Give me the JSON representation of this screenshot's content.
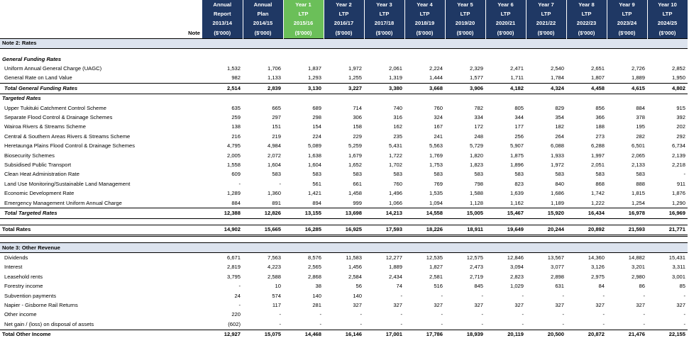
{
  "header": {
    "note": "Note",
    "columns": [
      {
        "l1": "Annual",
        "l2": "Report",
        "l3": "2013/14",
        "l4": "($'000)",
        "hl": false
      },
      {
        "l1": "Annual",
        "l2": "Plan",
        "l3": "2014/15",
        "l4": "($'000)",
        "hl": false
      },
      {
        "l1": "Year 1",
        "l2": "LTP",
        "l3": "2015/16",
        "l4": "($'000)",
        "hl": true
      },
      {
        "l1": "Year 2",
        "l2": "LTP",
        "l3": "2016/17",
        "l4": "($'000)",
        "hl": false
      },
      {
        "l1": "Year 3",
        "l2": "LTP",
        "l3": "2017/18",
        "l4": "($'000)",
        "hl": false
      },
      {
        "l1": "Year 4",
        "l2": "LTP",
        "l3": "2018/19",
        "l4": "($'000)",
        "hl": false
      },
      {
        "l1": "Year 5",
        "l2": "LTP",
        "l3": "2019/20",
        "l4": "($'000)",
        "hl": false
      },
      {
        "l1": "Year 6",
        "l2": "LTP",
        "l3": "2020/21",
        "l4": "($'000)",
        "hl": false
      },
      {
        "l1": "Year 7",
        "l2": "LTP",
        "l3": "2021/22",
        "l4": "($'000)",
        "hl": false
      },
      {
        "l1": "Year 8",
        "l2": "LTP",
        "l3": "2022/23",
        "l4": "($'000)",
        "hl": false
      },
      {
        "l1": "Year 9",
        "l2": "LTP",
        "l3": "2023/24",
        "l4": "($'000)",
        "hl": false
      },
      {
        "l1": "Year 10",
        "l2": "LTP",
        "l3": "2024/25",
        "l4": "($'000)",
        "hl": false
      }
    ]
  },
  "rows": [
    {
      "type": "section",
      "label": "Note 2: Rates"
    },
    {
      "type": "spacer"
    },
    {
      "type": "subhead",
      "label": "General Funding Rates"
    },
    {
      "type": "item",
      "label": "Uniform Annual General Charge (UAGC)",
      "values": [
        "1,532",
        "1,706",
        "1,837",
        "1,972",
        "2,061",
        "2,224",
        "2,329",
        "2,471",
        "2,540",
        "2,651",
        "2,726",
        "2,852"
      ]
    },
    {
      "type": "item",
      "label": "General Rate on Land Value",
      "values": [
        "982",
        "1,133",
        "1,293",
        "1,255",
        "1,319",
        "1,444",
        "1,577",
        "1,711",
        "1,784",
        "1,807",
        "1,889",
        "1,950"
      ]
    },
    {
      "type": "total",
      "label": "Total General Funding Rates",
      "values": [
        "2,514",
        "2,839",
        "3,130",
        "3,227",
        "3,380",
        "3,668",
        "3,906",
        "4,182",
        "4,324",
        "4,458",
        "4,615",
        "4,802"
      ]
    },
    {
      "type": "subhead",
      "label": "Targeted Rates"
    },
    {
      "type": "item",
      "label": "Upper Tukituki Catchment Control Scheme",
      "values": [
        "635",
        "665",
        "689",
        "714",
        "740",
        "760",
        "782",
        "805",
        "829",
        "856",
        "884",
        "915"
      ]
    },
    {
      "type": "item",
      "label": "Separate Flood Control & Drainage Schemes",
      "values": [
        "259",
        "297",
        "298",
        "306",
        "316",
        "324",
        "334",
        "344",
        "354",
        "366",
        "378",
        "392"
      ]
    },
    {
      "type": "item",
      "label": "Wairoa Rivers & Streams Scheme",
      "values": [
        "138",
        "151",
        "154",
        "158",
        "162",
        "167",
        "172",
        "177",
        "182",
        "188",
        "195",
        "202"
      ]
    },
    {
      "type": "item",
      "label": "Central & Southern Areas Rivers & Streams Scheme",
      "values": [
        "216",
        "219",
        "224",
        "229",
        "235",
        "241",
        "248",
        "256",
        "264",
        "273",
        "282",
        "292"
      ]
    },
    {
      "type": "item",
      "label": "Heretaunga Plains Flood Control & Drainage Schemes",
      "values": [
        "4,795",
        "4,984",
        "5,089",
        "5,259",
        "5,431",
        "5,563",
        "5,729",
        "5,907",
        "6,088",
        "6,288",
        "6,501",
        "6,734"
      ]
    },
    {
      "type": "item",
      "label": "Biosecurity Schemes",
      "values": [
        "2,005",
        "2,072",
        "1,638",
        "1,679",
        "1,722",
        "1,769",
        "1,820",
        "1,875",
        "1,933",
        "1,997",
        "2,065",
        "2,139"
      ]
    },
    {
      "type": "item",
      "label": "Subsidised Public Transport",
      "values": [
        "1,558",
        "1,604",
        "1,604",
        "1,652",
        "1,702",
        "1,753",
        "1,823",
        "1,896",
        "1,972",
        "2,051",
        "2,133",
        "2,218"
      ]
    },
    {
      "type": "item",
      "label": "Clean Heat Administration Rate",
      "values": [
        "609",
        "583",
        "583",
        "583",
        "583",
        "583",
        "583",
        "583",
        "583",
        "583",
        "583",
        "-"
      ]
    },
    {
      "type": "item",
      "label": "Land Use Monitoring/Sustainable Land Management",
      "values": [
        "-",
        "-",
        "561",
        "661",
        "760",
        "769",
        "798",
        "823",
        "840",
        "868",
        "888",
        "911"
      ]
    },
    {
      "type": "item",
      "label": "Economic Development Rate",
      "values": [
        "1,289",
        "1,360",
        "1,421",
        "1,458",
        "1,496",
        "1,535",
        "1,588",
        "1,639",
        "1,686",
        "1,742",
        "1,815",
        "1,876"
      ]
    },
    {
      "type": "item",
      "label": "Emergency Management Uniform Annual Charge",
      "values": [
        "884",
        "891",
        "894",
        "999",
        "1,066",
        "1,094",
        "1,128",
        "1,162",
        "1,189",
        "1,222",
        "1,254",
        "1,290"
      ]
    },
    {
      "type": "total",
      "label": "Total Targeted Rates",
      "values": [
        "12,388",
        "12,826",
        "13,155",
        "13,698",
        "14,213",
        "14,558",
        "15,005",
        "15,467",
        "15,920",
        "16,434",
        "16,978",
        "16,969"
      ]
    },
    {
      "type": "spacer"
    },
    {
      "type": "grand",
      "label": "Total Rates",
      "values": [
        "14,902",
        "15,665",
        "16,285",
        "16,925",
        "17,593",
        "18,226",
        "18,911",
        "19,649",
        "20,244",
        "20,892",
        "21,593",
        "21,771"
      ]
    },
    {
      "type": "spacer"
    },
    {
      "type": "section",
      "label": "Note 3: Other Revenue"
    },
    {
      "type": "item",
      "label": "Dividends",
      "values": [
        "6,671",
        "7,563",
        "8,576",
        "11,583",
        "12,277",
        "12,535",
        "12,575",
        "12,846",
        "13,567",
        "14,360",
        "14,882",
        "15,431"
      ]
    },
    {
      "type": "item",
      "label": "Interest",
      "values": [
        "2,819",
        "4,223",
        "2,565",
        "1,456",
        "1,889",
        "1,827",
        "2,473",
        "3,094",
        "3,077",
        "3,126",
        "3,201",
        "3,311"
      ]
    },
    {
      "type": "item",
      "label": "Leasehold rents",
      "values": [
        "3,795",
        "2,588",
        "2,868",
        "2,584",
        "2,434",
        "2,581",
        "2,719",
        "2,823",
        "2,898",
        "2,975",
        "2,980",
        "3,001"
      ]
    },
    {
      "type": "item",
      "label": "Forestry income",
      "values": [
        "-",
        "10",
        "38",
        "56",
        "74",
        "516",
        "845",
        "1,029",
        "631",
        "84",
        "86",
        "85"
      ]
    },
    {
      "type": "item",
      "label": "Subvention payments",
      "values": [
        "24",
        "574",
        "140",
        "140",
        "-",
        "-",
        "-",
        "-",
        "-",
        "-",
        "-",
        "-"
      ]
    },
    {
      "type": "item",
      "label": "Napier - Gisborne Rail Returns",
      "values": [
        "-",
        "117",
        "281",
        "327",
        "327",
        "327",
        "327",
        "327",
        "327",
        "327",
        "327",
        "327"
      ]
    },
    {
      "type": "item",
      "label": "Other income",
      "values": [
        "220",
        "-",
        "-",
        "-",
        "-",
        "-",
        "-",
        "-",
        "-",
        "-",
        "-",
        "-"
      ]
    },
    {
      "type": "item",
      "label": "Net gain / (loss) on disposal of assets",
      "values": [
        "(602)",
        "-",
        "-",
        "-",
        "-",
        "-",
        "-",
        "-",
        "-",
        "-",
        "-",
        "-"
      ]
    },
    {
      "type": "grand2",
      "label": "Total Other Income",
      "values": [
        "12,927",
        "15,075",
        "14,468",
        "16,146",
        "17,001",
        "17,786",
        "18,939",
        "20,119",
        "20,500",
        "20,872",
        "21,476",
        "22,155"
      ]
    }
  ]
}
